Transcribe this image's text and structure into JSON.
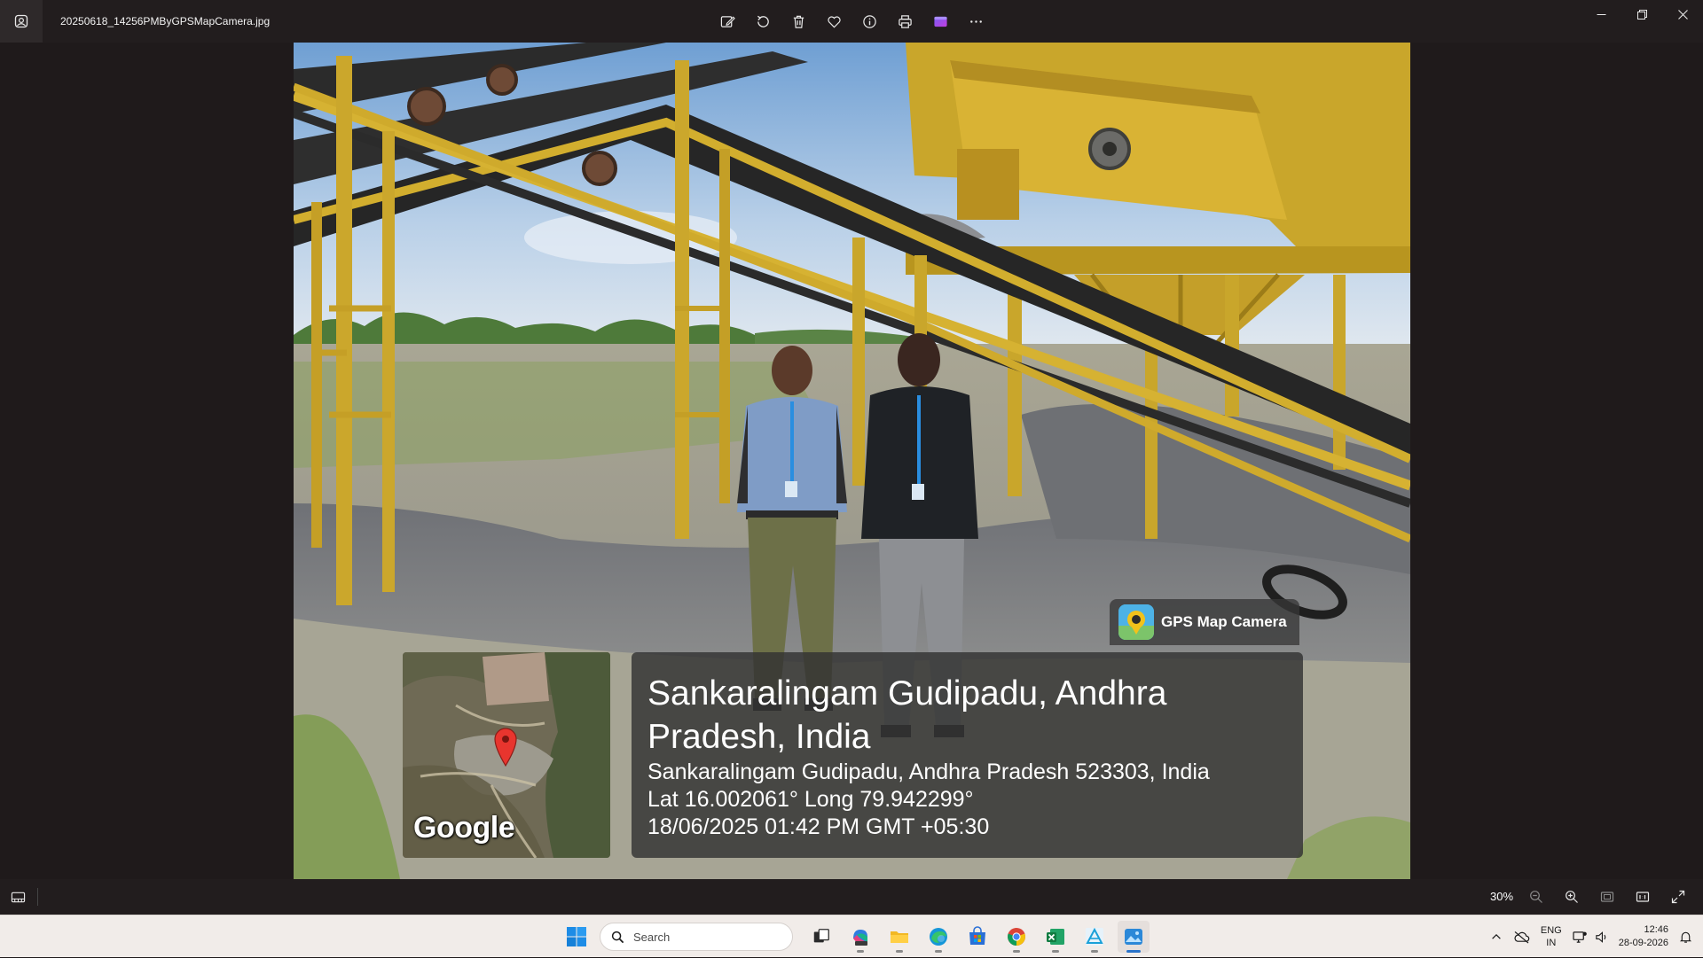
{
  "window": {
    "file_name": "20250618_14256PMByGPSMapCamera.jpg",
    "toolbar": [
      "edit",
      "rotate",
      "delete",
      "favorite",
      "info",
      "print",
      "clipchamp",
      "more"
    ]
  },
  "photo": {
    "badge": "GPS Map Camera",
    "map_brand": "Google",
    "location_title": "Sankaralingam Gudipadu, Andhra Pradesh, India",
    "address": "Sankaralingam Gudipadu, Andhra Pradesh 523303, India",
    "coordinates": "Lat 16.002061° Long 79.942299°",
    "timestamp": "18/06/2025 01:42 PM GMT +05:30"
  },
  "status": {
    "zoom": "30%"
  },
  "taskbar": {
    "search_placeholder": "Search",
    "lang_primary": "ENG",
    "lang_secondary": "IN",
    "time": "12:46",
    "date": "28-09-2026",
    "apps": [
      "task-view",
      "microsoft-365",
      "file-explorer",
      "edge",
      "microsoft-store",
      "chrome",
      "excel",
      "autocad",
      "photos"
    ]
  },
  "colors": {
    "frame": "#221d1e",
    "accent": "#2a73c9",
    "machine_yellow": "#d9b334",
    "pin_red": "#e8352e"
  }
}
